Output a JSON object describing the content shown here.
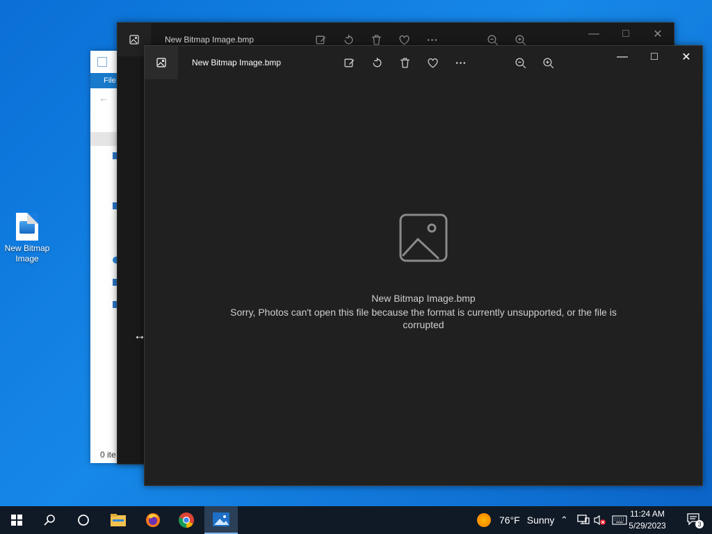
{
  "desktop": {
    "icon_label": "New Bitmap Image"
  },
  "explorer": {
    "ribbon_label": "File",
    "status": "0 ite"
  },
  "photos_back": {
    "filename": "New Bitmap Image.bmp"
  },
  "photos_front": {
    "filename": "New Bitmap Image.bmp",
    "error_title": "New Bitmap Image.bmp",
    "error_message": "Sorry, Photos can't open this file because the format is currently unsupported, or the file is corrupted"
  },
  "taskbar": {
    "weather_temp": "76°F",
    "weather_cond": "Sunny",
    "time": "11:24 AM",
    "date": "5/29/2023",
    "notification_count": "3"
  },
  "icons": [
    "windows-logo-icon",
    "search-icon",
    "cortana-icon",
    "file-explorer-icon",
    "firefox-icon",
    "chrome-icon",
    "photos-icon",
    "weather-sun-icon",
    "chevron-up-icon",
    "network-icon",
    "volume-muted-icon",
    "keyboard-icon",
    "notification-icon",
    "edit-icon",
    "rotate-icon",
    "delete-icon",
    "heart-icon",
    "more-icon",
    "zoom-out-icon",
    "zoom-in-icon",
    "minimize-icon",
    "maximize-icon",
    "close-icon",
    "broken-image-icon"
  ],
  "colors": {
    "photos_bg": "#202020",
    "taskbar_bg": "#101a27",
    "explorer_ribbon": "#1979ca"
  }
}
